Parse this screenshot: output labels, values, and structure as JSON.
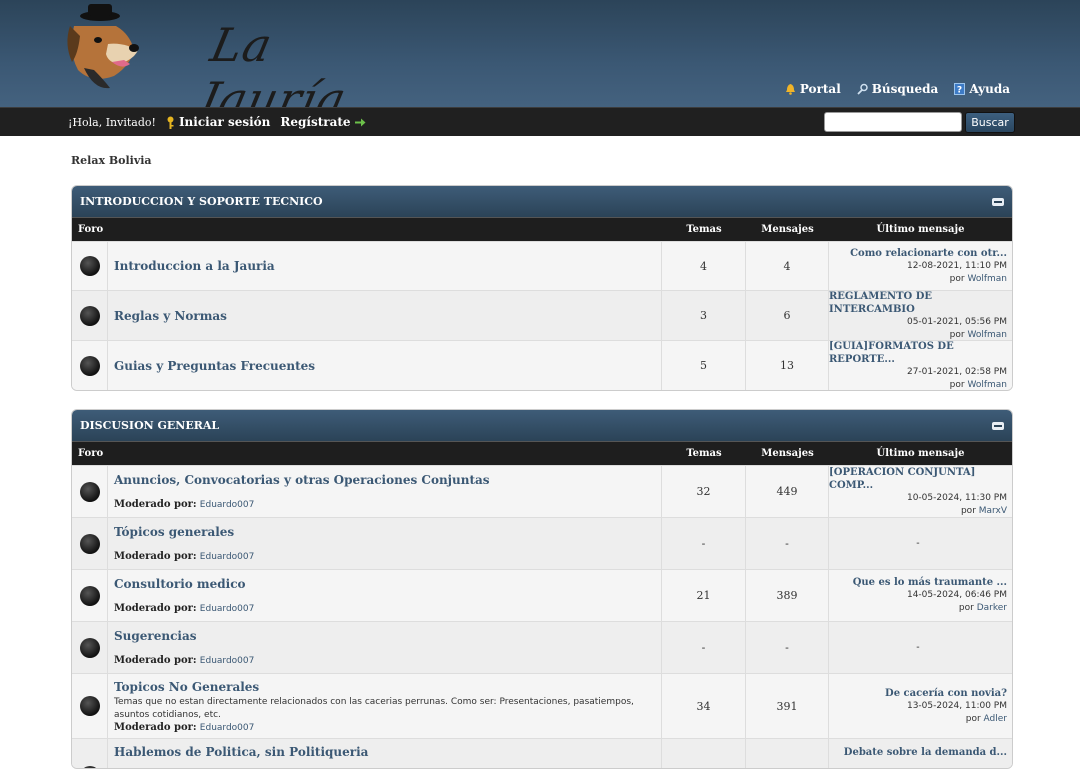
{
  "header": {
    "logo_text": "La Jauría",
    "links": [
      "Portal",
      "Búsqueda",
      "Ayuda"
    ]
  },
  "panel": {
    "greeting": "¡Hola, Invitado!",
    "login": "Iniciar sesión",
    "register": "Regístrate",
    "search_button": "Buscar"
  },
  "breadcrumb": "Relax Bolivia",
  "columns": {
    "forum": "Foro",
    "topics": "Temas",
    "posts": "Mensajes",
    "last": "Último mensaje"
  },
  "categories": [
    {
      "title": "INTRODUCCION Y SOPORTE TECNICO",
      "forums": [
        {
          "name": "Introduccion a la Jauria",
          "topics": "4",
          "posts": "4",
          "last_title": "Como relacionarte con otr...",
          "last_date": "12-08-2021, 11:10 PM",
          "by": "por",
          "last_user": "Wolfman"
        },
        {
          "name": "Reglas y Normas",
          "topics": "3",
          "posts": "6",
          "last_title": "REGLAMENTO DE INTERCAMBIO",
          "last_date": "05-01-2021, 05:56 PM",
          "by": "por",
          "last_user": "Wolfman"
        },
        {
          "name": "Guias y Preguntas Frecuentes",
          "topics": "5",
          "posts": "13",
          "last_title": "[GUIA]FORMATOS DE REPORTE...",
          "last_date": "27-01-2021, 02:58 PM",
          "by": "por",
          "last_user": "Wolfman"
        }
      ]
    },
    {
      "title": "DISCUSION GENERAL",
      "moderated_by": "Moderado por:",
      "forums": [
        {
          "name": "Anuncios, Convocatorias y otras Operaciones Conjuntas",
          "moderator": "Eduardo007",
          "topics": "32",
          "posts": "449",
          "last_title": "[OPERACION CONJUNTA] COMP...",
          "last_date": "10-05-2024, 11:30 PM",
          "by": "por",
          "last_user": "MarxV"
        },
        {
          "name": "Tópicos generales",
          "moderator": "Eduardo007",
          "topics": "-",
          "posts": "-",
          "last_empty": "-"
        },
        {
          "name": "Consultorio medico",
          "moderator": "Eduardo007",
          "topics": "21",
          "posts": "389",
          "last_title": "Que es lo más traumante ...",
          "last_date": "14-05-2024, 06:46 PM",
          "by": "por",
          "last_user": "Darker"
        },
        {
          "name": "Sugerencias",
          "moderator": "Eduardo007",
          "topics": "-",
          "posts": "-",
          "last_empty": "-"
        },
        {
          "name": "Topicos No Generales",
          "description": "Temas que no estan directamente relacionados con las cacerias perrunas. Como ser: Presentaciones, pasatiempos, asuntos cotidianos, etc.",
          "moderator": "Eduardo007",
          "topics": "34",
          "posts": "391",
          "last_title": "De cacería con novia?",
          "last_date": "13-05-2024, 11:00 PM",
          "by": "por",
          "last_user": "Adler"
        },
        {
          "name": "Hablemos de Politica, sin Politiqueria",
          "last_title": "Debate sobre la demanda d..."
        }
      ]
    }
  ]
}
